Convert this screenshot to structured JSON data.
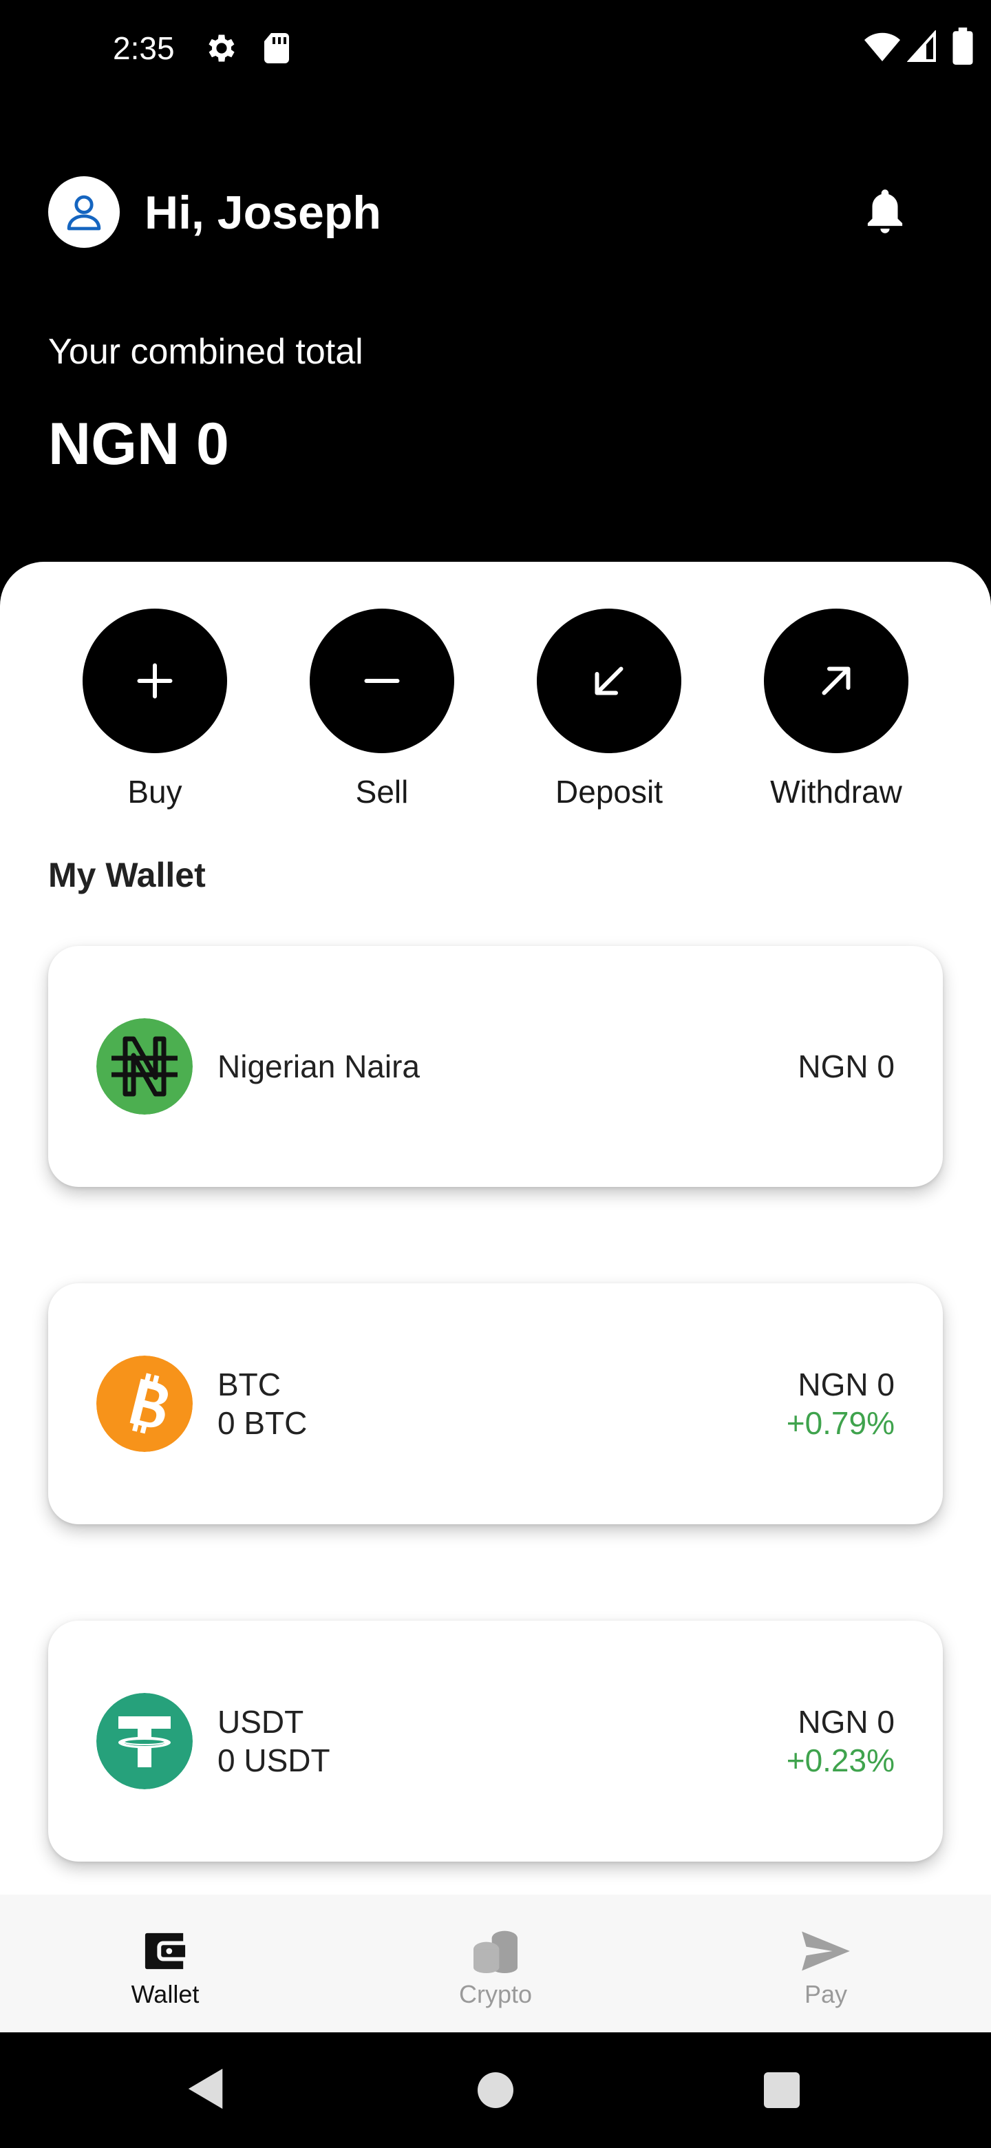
{
  "status_bar": {
    "time": "2:35",
    "icons": [
      "gear-icon",
      "sd-card-icon",
      "wifi-icon",
      "signal-icon",
      "battery-icon"
    ]
  },
  "header": {
    "greeting": "Hi, Joseph",
    "total_label": "Your combined total",
    "total_value": "NGN 0",
    "icons": [
      "user-icon",
      "bell-icon"
    ]
  },
  "actions": [
    {
      "label": "Buy",
      "icon": "plus-icon"
    },
    {
      "label": "Sell",
      "icon": "minus-icon"
    },
    {
      "label": "Deposit",
      "icon": "arrow-down-left-icon"
    },
    {
      "label": "Withdraw",
      "icon": "arrow-up-right-icon"
    }
  ],
  "wallet": {
    "title": "My Wallet",
    "items": [
      {
        "name": "Nigerian Naira",
        "value": "NGN 0",
        "icon": "naira-icon",
        "icon_color": "#4caf50"
      },
      {
        "name": "BTC",
        "balance": "0 BTC",
        "value": "NGN 0",
        "change": "+0.79%",
        "icon": "bitcoin-icon",
        "icon_color": "#f7931a"
      },
      {
        "name": "USDT",
        "balance": "0 USDT",
        "value": "NGN 0",
        "change": "+0.23%",
        "icon": "tether-icon",
        "icon_color": "#26a17b"
      }
    ]
  },
  "bottom_nav": {
    "items": [
      {
        "label": "Wallet",
        "icon": "wallet-icon",
        "active": true
      },
      {
        "label": "Crypto",
        "icon": "coins-icon",
        "active": false
      },
      {
        "label": "Pay",
        "icon": "send-icon",
        "active": false
      }
    ]
  },
  "colors": {
    "header_bg": "#000000",
    "sheet_bg": "#ffffff",
    "positive_change": "#3fa34d",
    "nav_bg": "#f7f7f7"
  }
}
